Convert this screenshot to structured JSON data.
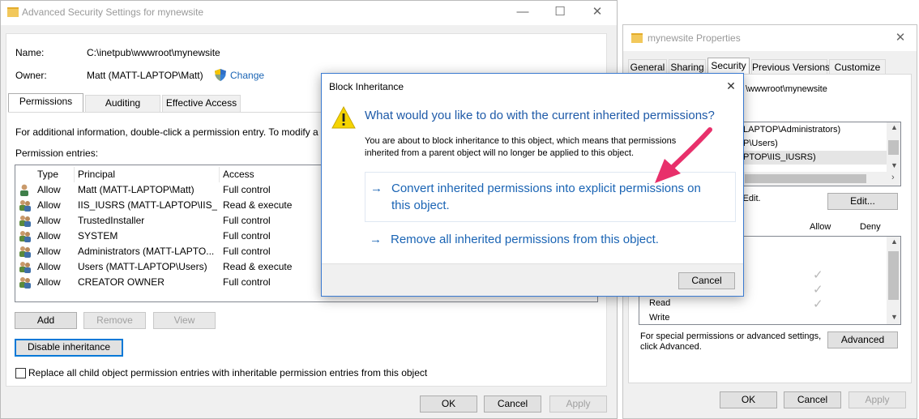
{
  "main_window": {
    "title": "Advanced Security Settings for mynewsite",
    "name_label": "Name:",
    "name_value": "C:\\inetpub\\wwwroot\\mynewsite",
    "owner_label": "Owner:",
    "owner_value": "Matt (MATT-LAPTOP\\Matt)",
    "change_link": "Change",
    "tabs": [
      {
        "label": "Permissions",
        "active": true
      },
      {
        "label": "Auditing",
        "active": false
      },
      {
        "label": "Effective Access",
        "active": false
      }
    ],
    "info_text": "For additional information, double-click a permission entry. To modify a",
    "entries_label": "Permission entries:",
    "columns": [
      "Type",
      "Principal",
      "Access"
    ],
    "entries": [
      {
        "type": "Allow",
        "principal": "Matt (MATT-LAPTOP\\Matt)",
        "access": "Full control",
        "icon": "single-user-icon"
      },
      {
        "type": "Allow",
        "principal": "IIS_IUSRS (MATT-LAPTOP\\IIS_...",
        "access": "Read & execute",
        "icon": "group-users-icon"
      },
      {
        "type": "Allow",
        "principal": "TrustedInstaller",
        "access": "Full control",
        "icon": "group-users-icon"
      },
      {
        "type": "Allow",
        "principal": "SYSTEM",
        "access": "Full control",
        "icon": "group-users-icon"
      },
      {
        "type": "Allow",
        "principal": "Administrators (MATT-LAPTO...",
        "access": "Full control",
        "icon": "group-users-icon"
      },
      {
        "type": "Allow",
        "principal": "Users (MATT-LAPTOP\\Users)",
        "access": "Read & execute",
        "icon": "group-users-icon"
      },
      {
        "type": "Allow",
        "principal": "CREATOR OWNER",
        "access": "Full control",
        "icon": "group-users-icon"
      }
    ],
    "add_button": "Add",
    "remove_button": "Remove",
    "view_button": "View",
    "disable_inheritance_button": "Disable inheritance",
    "replace_checkbox_label": "Replace all child object permission entries with inheritable permission entries from this object",
    "ok_button": "OK",
    "cancel_button": "Cancel",
    "apply_button": "Apply"
  },
  "properties_window": {
    "title": "mynewsite Properties",
    "tabs": [
      {
        "label": "General",
        "active": false
      },
      {
        "label": "Sharing",
        "active": false
      },
      {
        "label": "Security",
        "active": true
      },
      {
        "label": "Previous Versions",
        "active": false
      },
      {
        "label": "Customize",
        "active": false
      }
    ],
    "object_path_partial": "\\wwwroot\\mynewsite",
    "users_partial": [
      "LAPTOP\\Administrators)",
      "P\\Users)",
      "PTOP\\IIS_IUSRS)"
    ],
    "edit_hint_partial": "k Edit.",
    "edit_button": "Edit...",
    "allow_header": "Allow",
    "deny_header": "Deny",
    "permissions_partial": [
      "Read",
      "Write"
    ],
    "special_text_line1": "For special permissions or advanced settings,",
    "special_text_line2": "click Advanced.",
    "advanced_button": "Advanced",
    "ok_button": "OK",
    "cancel_button": "Cancel",
    "apply_button": "Apply"
  },
  "dialog": {
    "title": "Block Inheritance",
    "question": "What would you like to do with the current inherited permissions?",
    "description_line1": "You are about to block inheritance to this object, which means that permissions",
    "description_line2": "inherited from a parent object will no longer be applied to this object.",
    "option1_line1": "Convert inherited permissions into explicit permissions on",
    "option1_line2": "this object.",
    "option2": "Remove all inherited permissions from this object.",
    "arrow_glyph": "→",
    "cancel_button": "Cancel"
  },
  "colors": {
    "accent": "#0078d7",
    "link": "#1a64b4",
    "question": "#1e5aa8",
    "annotation_arrow": "#e8306b",
    "warning": "#f5d400"
  }
}
